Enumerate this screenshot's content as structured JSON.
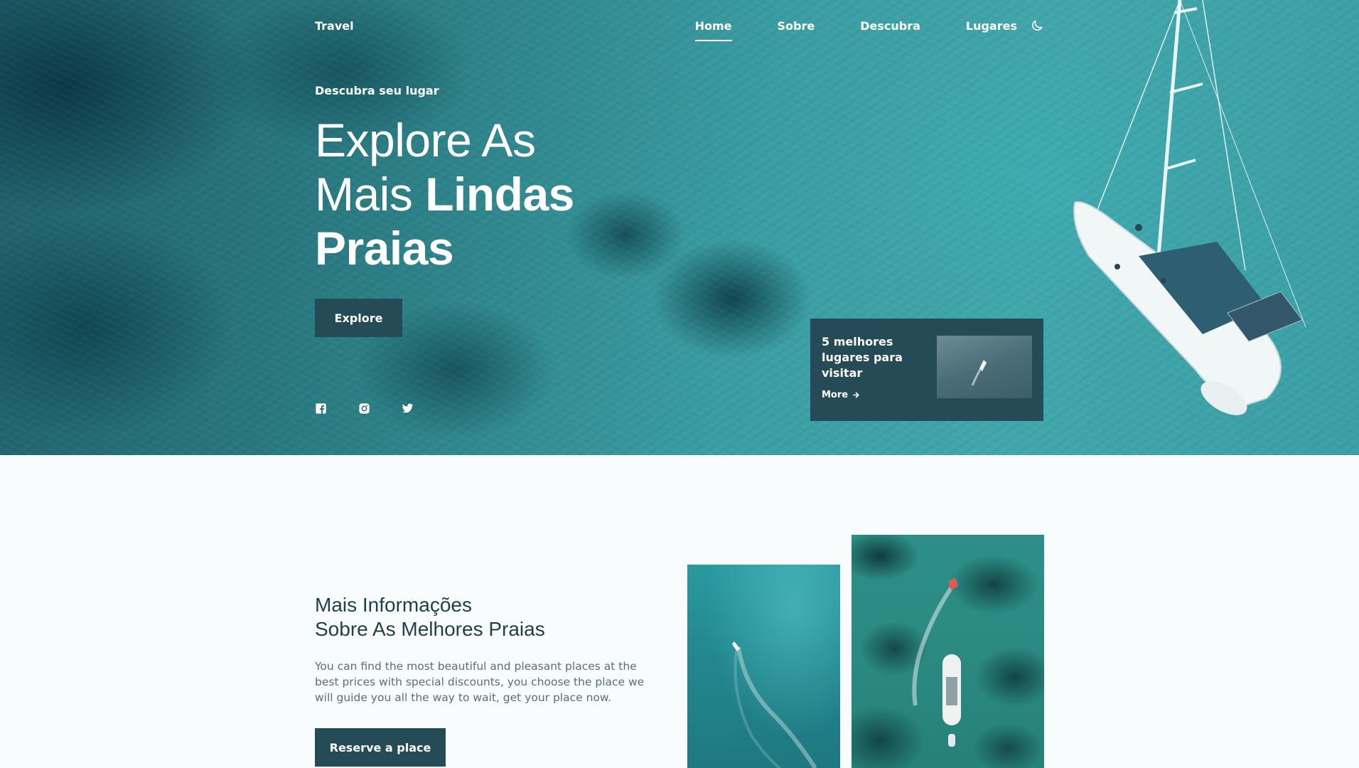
{
  "nav": {
    "logo": "Travel",
    "links": [
      {
        "label": "Home",
        "active": true
      },
      {
        "label": "Sobre",
        "active": false
      },
      {
        "label": "Descubra",
        "active": false
      },
      {
        "label": "Lugares",
        "active": false
      }
    ],
    "theme_icon": "moon-icon"
  },
  "hero": {
    "subtitle": "Descubra seu lugar",
    "title_line1": "Explore As",
    "title_line2_regular": "Mais ",
    "title_line2_bold": "Lindas",
    "title_line3": "Praias",
    "button_label": "Explore",
    "socials": [
      "facebook-icon",
      "instagram-icon",
      "twitter-icon"
    ]
  },
  "card": {
    "title": "5 melhores lugares para visitar",
    "more_label": "More",
    "more_icon": "arrow-right-icon"
  },
  "about": {
    "title_line1": "Mais Informações",
    "title_line2": "Sobre As Melhores Praias",
    "text": "You can find the most beautiful and pleasant places at the best prices with special discounts, you choose the place we will guide you all the way to wait, get your place now.",
    "button_label": "Reserve a place"
  },
  "colors": {
    "accent": "#254b56",
    "title_text": "#1f3f4a",
    "body_text": "#5c6e74",
    "background": "#f8fcfd"
  }
}
